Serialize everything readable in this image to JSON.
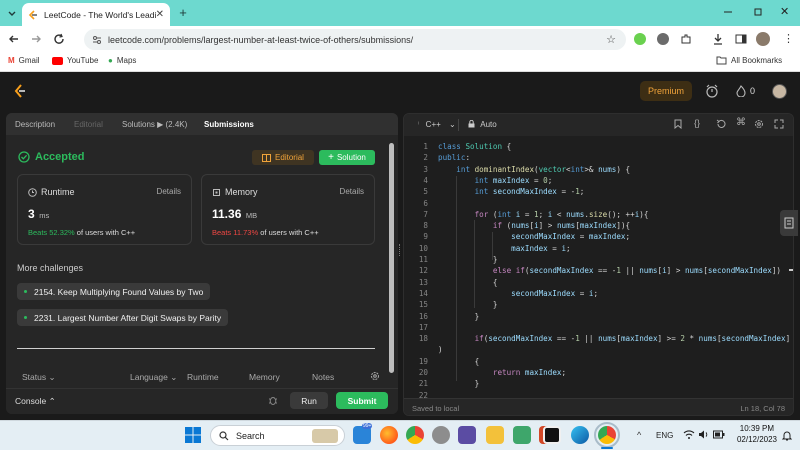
{
  "browser": {
    "tab_title": "LeetCode - The World's Leadin",
    "url": "leetcode.com/problems/largest-number-at-least-twice-of-others/submissions/",
    "bookmarks": [
      "Gmail",
      "YouTube",
      "Maps"
    ],
    "all_bookmarks": "All Bookmarks"
  },
  "header": {
    "premium_label": "Premium",
    "streak_count": "0"
  },
  "left_tabs": [
    "Description",
    "Editorial",
    "Solutions ▶ (2.4K)",
    "Submissions"
  ],
  "result": {
    "status": "Accepted",
    "editorial_button": "Editorial",
    "solution_button": "Solution"
  },
  "runtime": {
    "label": "Runtime",
    "details": "Details",
    "value": "3",
    "unit": "ms",
    "beats": "Beats 52.32%",
    "beats_suffix": "of users with C++"
  },
  "memory": {
    "label": "Memory",
    "details": "Details",
    "value": "11.36",
    "unit": "MB",
    "beats": "Beats 11.73%",
    "beats_suffix": "of users with C++"
  },
  "more_challenges": {
    "title": "More challenges",
    "items": [
      "2154. Keep Multiplying Found Values by Two",
      "2231. Largest Number After Digit Swaps by Parity"
    ]
  },
  "table_headers": [
    "Status",
    "Language",
    "Runtime",
    "Memory",
    "Notes"
  ],
  "console": {
    "label": "Console",
    "run": "Run",
    "submit": "Submit"
  },
  "editor": {
    "language": "C++",
    "autosave": "Auto",
    "saved_status": "Saved to local",
    "cursor": "Ln 18, Col 78",
    "line_numbers": [
      "1",
      "2",
      "3",
      "4",
      "5",
      "6",
      "7",
      "8",
      "9",
      "10",
      "11",
      "12",
      "13",
      "14",
      "15",
      "16",
      "17",
      "18",
      "19",
      "20",
      "21",
      "22"
    ]
  },
  "taskbar": {
    "search": "Search",
    "language": "ENG",
    "time": "10:39 PM",
    "date": "02/12/2023",
    "chat_badge": "99+"
  },
  "colors": {
    "accent_green": "#2cbb5d",
    "beats_red": "#ef4743",
    "premium_orange": "#f0a33a",
    "browser_frame": "#6dd9cf"
  }
}
